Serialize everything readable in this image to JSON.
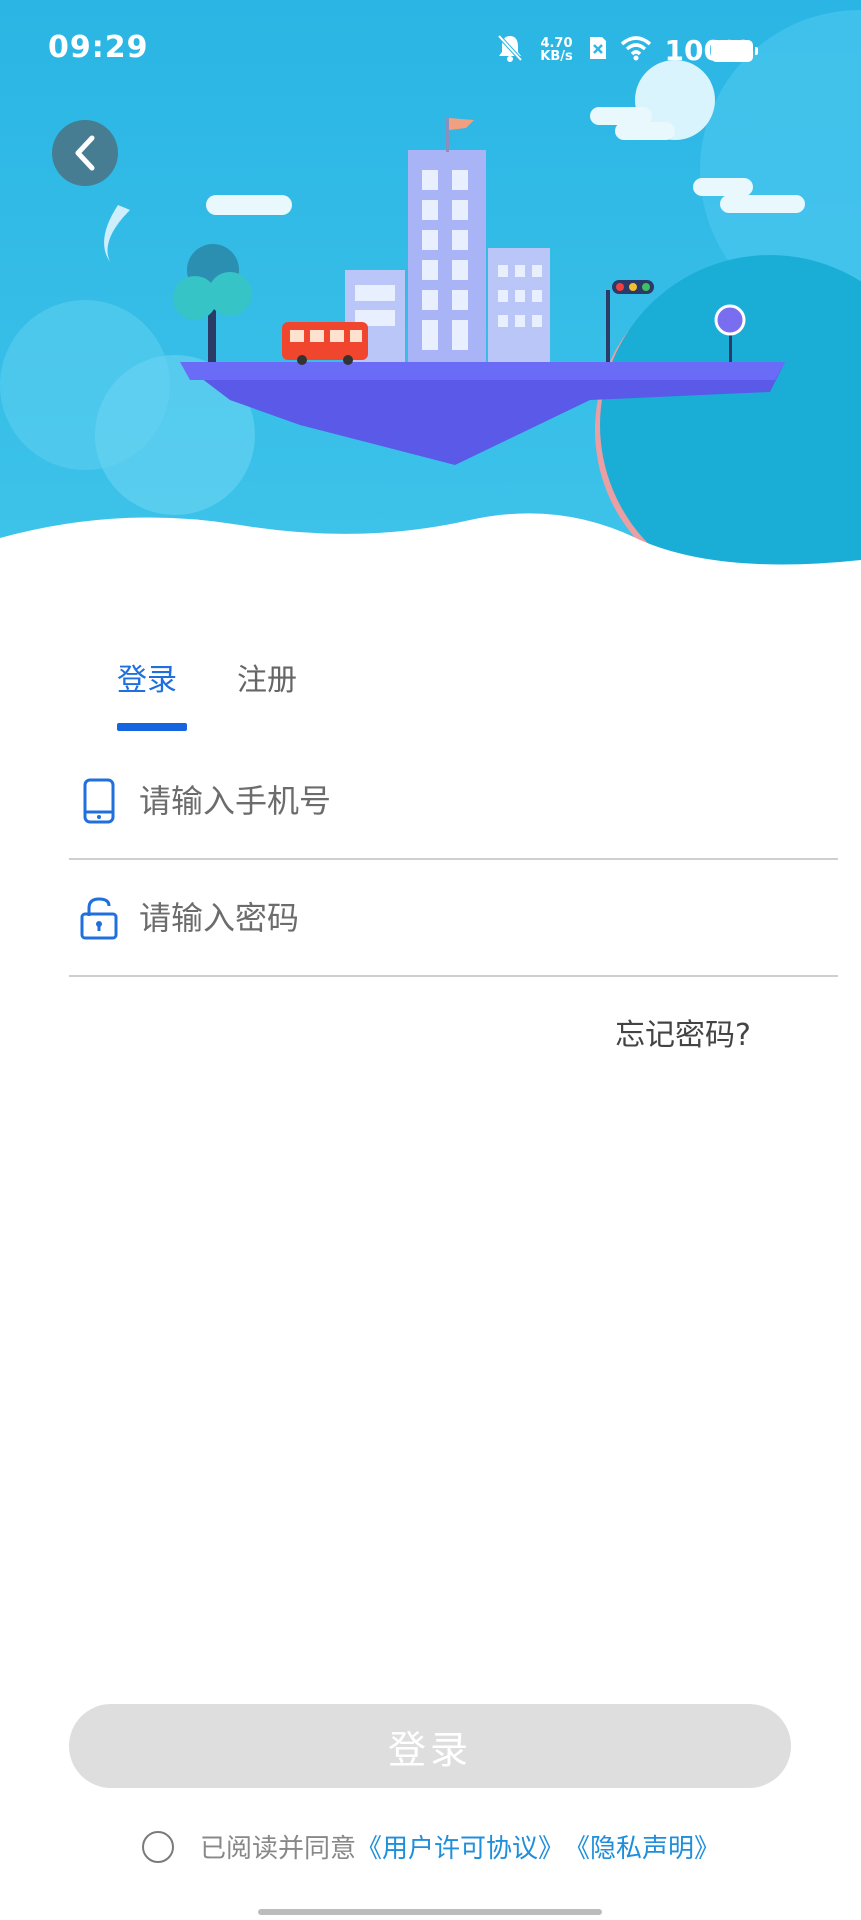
{
  "status_bar": {
    "time": "09:29",
    "net_speed_value": "4.70",
    "net_speed_unit": "KB/s",
    "battery": "100%",
    "icons": [
      "mute-bell-icon",
      "sim-x-icon",
      "wifi-icon",
      "battery-icon"
    ]
  },
  "back_icon": "chevron-left-icon",
  "tabs": [
    {
      "label": "登录",
      "active": true
    },
    {
      "label": "注册",
      "active": false
    }
  ],
  "form": {
    "phone_placeholder": "请输入手机号",
    "phone_value": "",
    "phone_icon": "phone-icon",
    "password_placeholder": "请输入密码",
    "password_value": "",
    "password_icon": "lock-icon",
    "forgot_label": "忘记密码?"
  },
  "login_button_label": "登录",
  "agreement": {
    "prefix": "已阅读并同意",
    "user_license": "《用户许可协议》",
    "privacy": "《隐私声明》",
    "checked": false
  },
  "colors": {
    "accent": "#1f6fdd",
    "link": "#1f8fdc",
    "sky": "#2fb8e3",
    "button_disabled": "#dedede"
  }
}
